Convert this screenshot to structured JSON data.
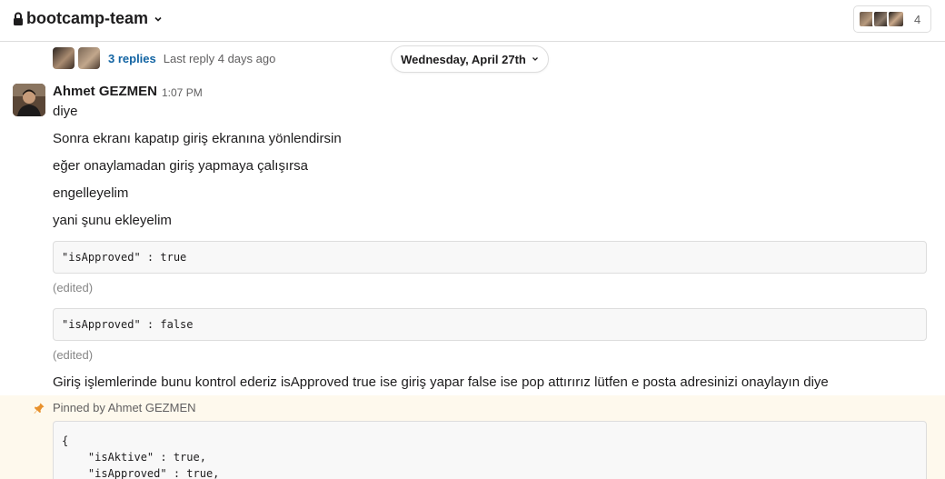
{
  "header": {
    "channel_name": "bootcamp-team",
    "member_count": "4"
  },
  "thread": {
    "replies": "3 replies",
    "last_reply": "Last reply 4 days ago"
  },
  "date_divider": "Wednesday, April 27th",
  "message": {
    "author": "Ahmet GEZMEN",
    "time": "1:07 PM",
    "lines": [
      "diye",
      "Sonra ekranı kapatıp giriş ekranına yönlendirsin",
      "eğer onaylamadan giriş yapmaya çalışırsa",
      "engelleyelim",
      "yani şunu ekleyelim"
    ],
    "code1": "\"isApproved\" : true",
    "edited1": "(edited)",
    "code2": "\"isApproved\" : false",
    "edited2": "(edited)",
    "final_line": "Giriş işlemlerinde bunu kontrol ederiz isApproved true ise giriş yapar false ise pop attırırız lütfen e posta adresinizi onaylayın diye"
  },
  "pinned": {
    "label": "Pinned by Ahmet GEZMEN",
    "code_lines": [
      "{",
      "    \"isAktive\" : true,",
      "    \"isApproved\" : true,"
    ]
  },
  "icons": [
    "lock-icon",
    "chevron-down-icon",
    "pin-icon"
  ],
  "colors": {
    "link": "#1264a3",
    "pinned_bg": "#fef9ed",
    "pin_accent": "#e8912d"
  }
}
